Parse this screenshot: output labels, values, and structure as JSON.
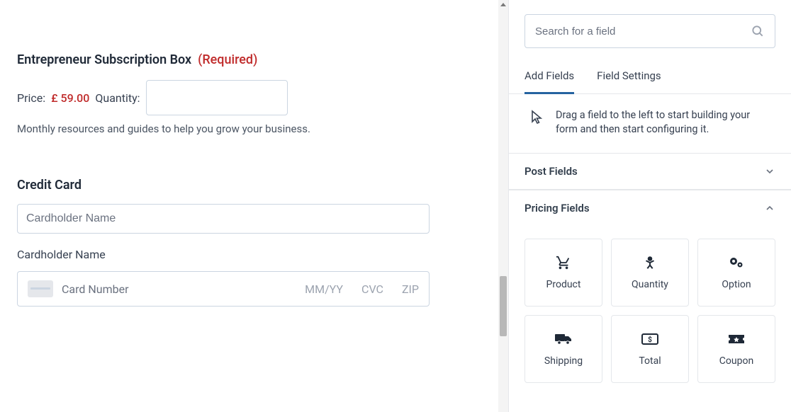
{
  "product_field": {
    "title": "Entrepreneur Subscription Box",
    "required_label": "(Required)",
    "price_label": "Price:",
    "price_value": "£ 59.00",
    "quantity_label": "Quantity:",
    "description": "Monthly resources and guides to help you grow your business."
  },
  "credit_card": {
    "title": "Credit Card",
    "name_placeholder": "Cardholder Name",
    "name_sublabel": "Cardholder Name",
    "number_placeholder": "Card Number",
    "exp_placeholder": "MM/YY",
    "cvc_placeholder": "CVC",
    "zip_placeholder": "ZIP"
  },
  "sidebar": {
    "search_placeholder": "Search for a field",
    "tabs": [
      {
        "label": "Add Fields",
        "active": true
      },
      {
        "label": "Field Settings",
        "active": false
      }
    ],
    "hint": "Drag a field to the left to start building your form and then start configuring it.",
    "sections": [
      {
        "title": "Post Fields",
        "open": false
      },
      {
        "title": "Pricing Fields",
        "open": true
      }
    ],
    "pricing_fields": [
      {
        "name": "Product",
        "icon": "cart"
      },
      {
        "name": "Quantity",
        "icon": "person"
      },
      {
        "name": "Option",
        "icon": "gears"
      },
      {
        "name": "Shipping",
        "icon": "truck"
      },
      {
        "name": "Total",
        "icon": "money"
      },
      {
        "name": "Coupon",
        "icon": "ticket"
      }
    ]
  }
}
